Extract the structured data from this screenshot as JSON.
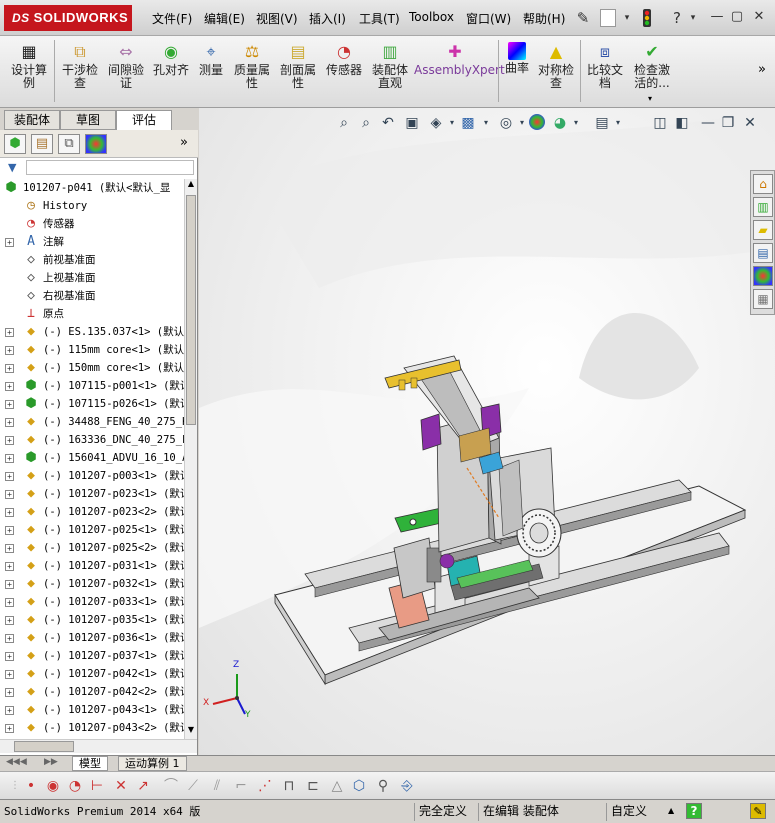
{
  "app": {
    "logo": "SOLIDWORKS",
    "logo_mark": "DS"
  },
  "menu": [
    "文件(F)",
    "编辑(E)",
    "视图(V)",
    "插入(I)",
    "工具(T)",
    "Toolbox",
    "窗口(W)",
    "帮助(H)"
  ],
  "toolbar": [
    {
      "label": "设计算\n例",
      "icon": "design-study-icon"
    },
    {
      "label": "干涉检\n查",
      "icon": "interference-icon"
    },
    {
      "label": "间隙验\n证",
      "icon": "clearance-icon"
    },
    {
      "label": "孔对齐",
      "icon": "hole-align-icon"
    },
    {
      "label": "测量",
      "icon": "measure-icon"
    },
    {
      "label": "质量属\n性",
      "icon": "mass-props-icon"
    },
    {
      "label": "剖面属\n性",
      "icon": "section-props-icon"
    },
    {
      "label": "传感器",
      "icon": "sensor-icon"
    },
    {
      "label": "装配体\n直观",
      "icon": "assembly-visual-icon"
    },
    {
      "label": "AssemblyXpert",
      "icon": "assemblyxpert-icon"
    },
    {
      "label": "曲率",
      "icon": "curvature-icon"
    },
    {
      "label": "对称检\n查",
      "icon": "symmetry-icon"
    },
    {
      "label": "比较文\n档",
      "icon": "compare-icon"
    },
    {
      "label": "检查激\n活的...",
      "icon": "check-active-icon"
    }
  ],
  "left_tabs": [
    "装配体",
    "草图",
    "评估"
  ],
  "active_left_tab": "评估",
  "tree": [
    {
      "label": "101207-p041  (默认<默认_显",
      "icon": "assembly-icon",
      "expand": "",
      "root": true
    },
    {
      "label": "History",
      "icon": "history-icon",
      "expand": ""
    },
    {
      "label": "传感器",
      "icon": "sensor-icon",
      "expand": ""
    },
    {
      "label": "注解",
      "icon": "annotation-icon",
      "expand": "+"
    },
    {
      "label": "前视基准面",
      "icon": "plane-icon",
      "expand": ""
    },
    {
      "label": "上视基准面",
      "icon": "plane-icon",
      "expand": ""
    },
    {
      "label": "右视基准面",
      "icon": "plane-icon",
      "expand": ""
    },
    {
      "label": "原点",
      "icon": "origin-icon",
      "expand": ""
    },
    {
      "label": "(-) ES.135.037<1> (默认",
      "icon": "part-icon",
      "expand": "+"
    },
    {
      "label": "(-) 115mm core<1> (默认",
      "icon": "part-icon",
      "expand": "+"
    },
    {
      "label": "(-) 150mm core<1> (默认",
      "icon": "part-icon",
      "expand": "+"
    },
    {
      "label": "(-) 107115-p001<1> (默认",
      "icon": "subassembly-icon",
      "expand": "+"
    },
    {
      "label": "(-) 107115-p026<1> (默认",
      "icon": "subassembly-icon",
      "expand": "+"
    },
    {
      "label": "(-) 34488_FENG_40_275_K",
      "icon": "part-icon",
      "expand": "+"
    },
    {
      "label": "(-) 163336_DNC_40_275_P",
      "icon": "part-icon",
      "expand": "+"
    },
    {
      "label": "(-) 156041_ADVU_16_10_A",
      "icon": "subassembly-icon",
      "expand": "+"
    },
    {
      "label": "(-) 101207-p003<1> (默认",
      "icon": "part-icon",
      "expand": "+"
    },
    {
      "label": "(-) 101207-p023<1> (默认",
      "icon": "part-icon",
      "expand": "+"
    },
    {
      "label": "(-) 101207-p023<2> (默认",
      "icon": "part-icon",
      "expand": "+"
    },
    {
      "label": "(-) 101207-p025<1> (默认",
      "icon": "part-icon",
      "expand": "+"
    },
    {
      "label": "(-) 101207-p025<2> (默认",
      "icon": "part-icon",
      "expand": "+"
    },
    {
      "label": "(-) 101207-p031<1> (默认",
      "icon": "part-icon",
      "expand": "+"
    },
    {
      "label": "(-) 101207-p032<1> (默认",
      "icon": "part-icon",
      "expand": "+"
    },
    {
      "label": "(-) 101207-p033<1> (默认",
      "icon": "part-icon",
      "expand": "+"
    },
    {
      "label": "(-) 101207-p035<1> (默认",
      "icon": "part-icon",
      "expand": "+"
    },
    {
      "label": "(-) 101207-p036<1> (默认",
      "icon": "part-icon",
      "expand": "+"
    },
    {
      "label": "(-) 101207-p037<1> (默认",
      "icon": "part-icon",
      "expand": "+"
    },
    {
      "label": "(-) 101207-p042<1> (默认",
      "icon": "part-icon",
      "expand": "+"
    },
    {
      "label": "(-) 101207-p042<2> (默认",
      "icon": "part-icon",
      "expand": "+"
    },
    {
      "label": "(-) 101207-p043<1> (默认",
      "icon": "part-icon",
      "expand": "+"
    },
    {
      "label": "(-) 101207-p043<2> (默认",
      "icon": "part-icon",
      "expand": "+"
    }
  ],
  "bottom_tabs": [
    "模型",
    "运动算例 1"
  ],
  "active_bottom_tab": "模型",
  "status": {
    "product": "SolidWorks Premium 2014 x64 版",
    "definition": "完全定义",
    "mode": "在编辑 装配体",
    "units": "自定义",
    "help": "?"
  },
  "triad": {
    "x": "X",
    "y": "Y",
    "z": "Z"
  },
  "colors": {
    "logo": "#c5161d",
    "viewport": "#f0f0f0",
    "part_yellow": "#e8c02e",
    "part_green": "#2fb23a",
    "part_purple": "#8a2fa8",
    "part_salmon": "#e89b85",
    "part_teal": "#25b2b0"
  }
}
